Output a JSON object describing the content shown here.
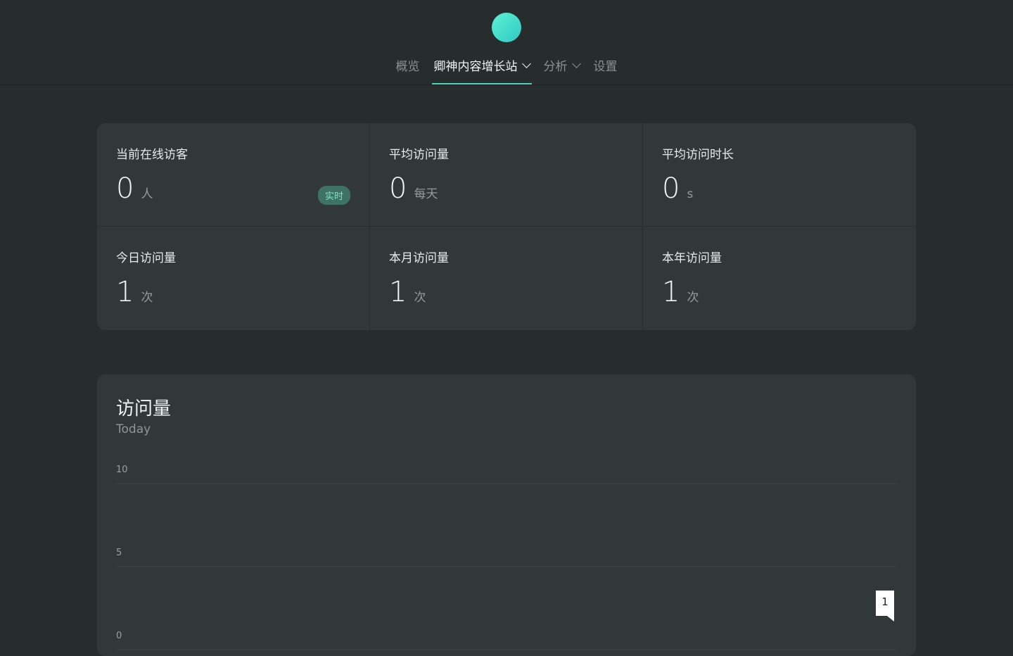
{
  "nav": {
    "items": [
      {
        "label": "概览"
      },
      {
        "label": "卿神内容增长站"
      },
      {
        "label": "分析"
      },
      {
        "label": "设置"
      }
    ]
  },
  "stats": [
    {
      "label": "当前在线访客",
      "value": "0",
      "unit": "人",
      "badge": "实时"
    },
    {
      "label": "平均访问量",
      "value": "0",
      "unit": "每天"
    },
    {
      "label": "平均访问时长",
      "value": "0",
      "unit": "s"
    },
    {
      "label": "今日访问量",
      "value": "1",
      "unit": "次"
    },
    {
      "label": "本月访问量",
      "value": "1",
      "unit": "次"
    },
    {
      "label": "本年访问量",
      "value": "1",
      "unit": "次"
    }
  ],
  "chart": {
    "title": "访问量",
    "subtitle": "Today"
  },
  "chart_data": {
    "type": "line",
    "ylim": [
      0,
      10
    ],
    "yticks": [
      "10",
      "5",
      "0"
    ],
    "grid": true,
    "series": [
      {
        "values": [
          1
        ]
      }
    ],
    "annotations": [
      "1"
    ]
  }
}
